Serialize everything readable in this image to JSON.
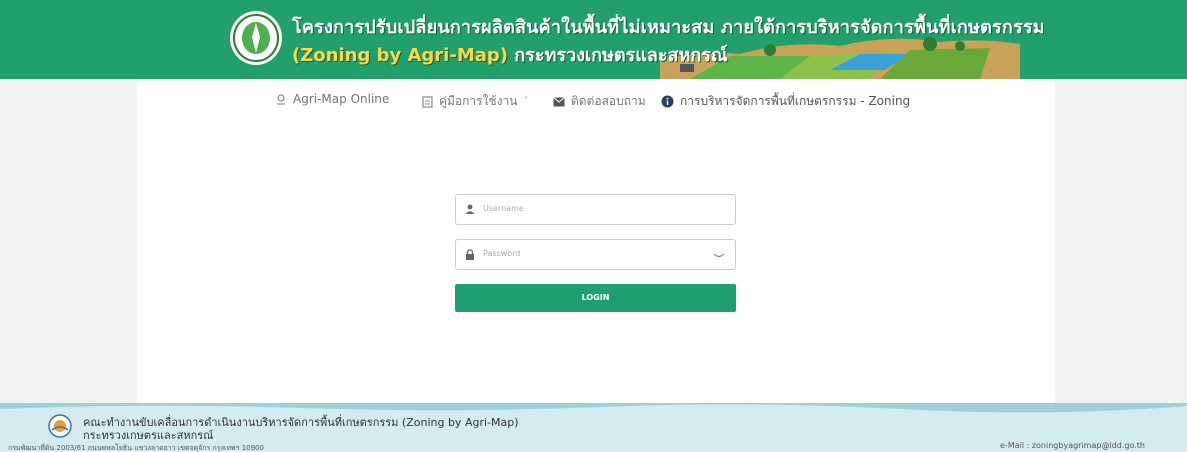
{
  "header": {
    "title_line1": "โครงการปรับเปลี่ยนการผลิตสินค้าในพื้นที่ไม่เหมาะสม ภายใต้การบริหารจัดการพื้นที่เกษตรกรรม",
    "title_line2_en": "(Zoning by Agri-Map)",
    "title_line2_th": "กระทรวงเกษตรและสหกรณ์",
    "bg_color": "#22a06b"
  },
  "nav": {
    "items": [
      {
        "label": "Agri-Map Online",
        "icon": "map-pin-icon"
      },
      {
        "label": "คู่มือการใช้งาน",
        "icon": "document-icon",
        "dropdown": true
      },
      {
        "label": "ติดต่อสอบถาม",
        "icon": "envelope-icon"
      },
      {
        "label": "การบริหารจัดการพื้นที่เกษตรกรรม - Zoning",
        "icon": "info-icon"
      }
    ],
    "dropdown_glyph": "˅"
  },
  "login": {
    "username_placeholder": "Username",
    "password_placeholder": "Password",
    "button_label": "LOGIN",
    "accent": "#209e6f"
  },
  "footer": {
    "line1": "คณะทำงานขับเคลื่อนการดำเนินงานบริหารจัดการพื้นที่เกษตรกรรม (Zoning by Agri-Map)",
    "line2": "กระทรวงเกษตรและสหกรณ์",
    "address": "กรมพัฒนาที่ดิน 2003/61 ถนนพหลโยธิน แขวงลาดยาว เขตจตุจักร กรุงเทพฯ 10900",
    "email": "e-Mail : zoningbyagrimap@ldd.go.th"
  }
}
